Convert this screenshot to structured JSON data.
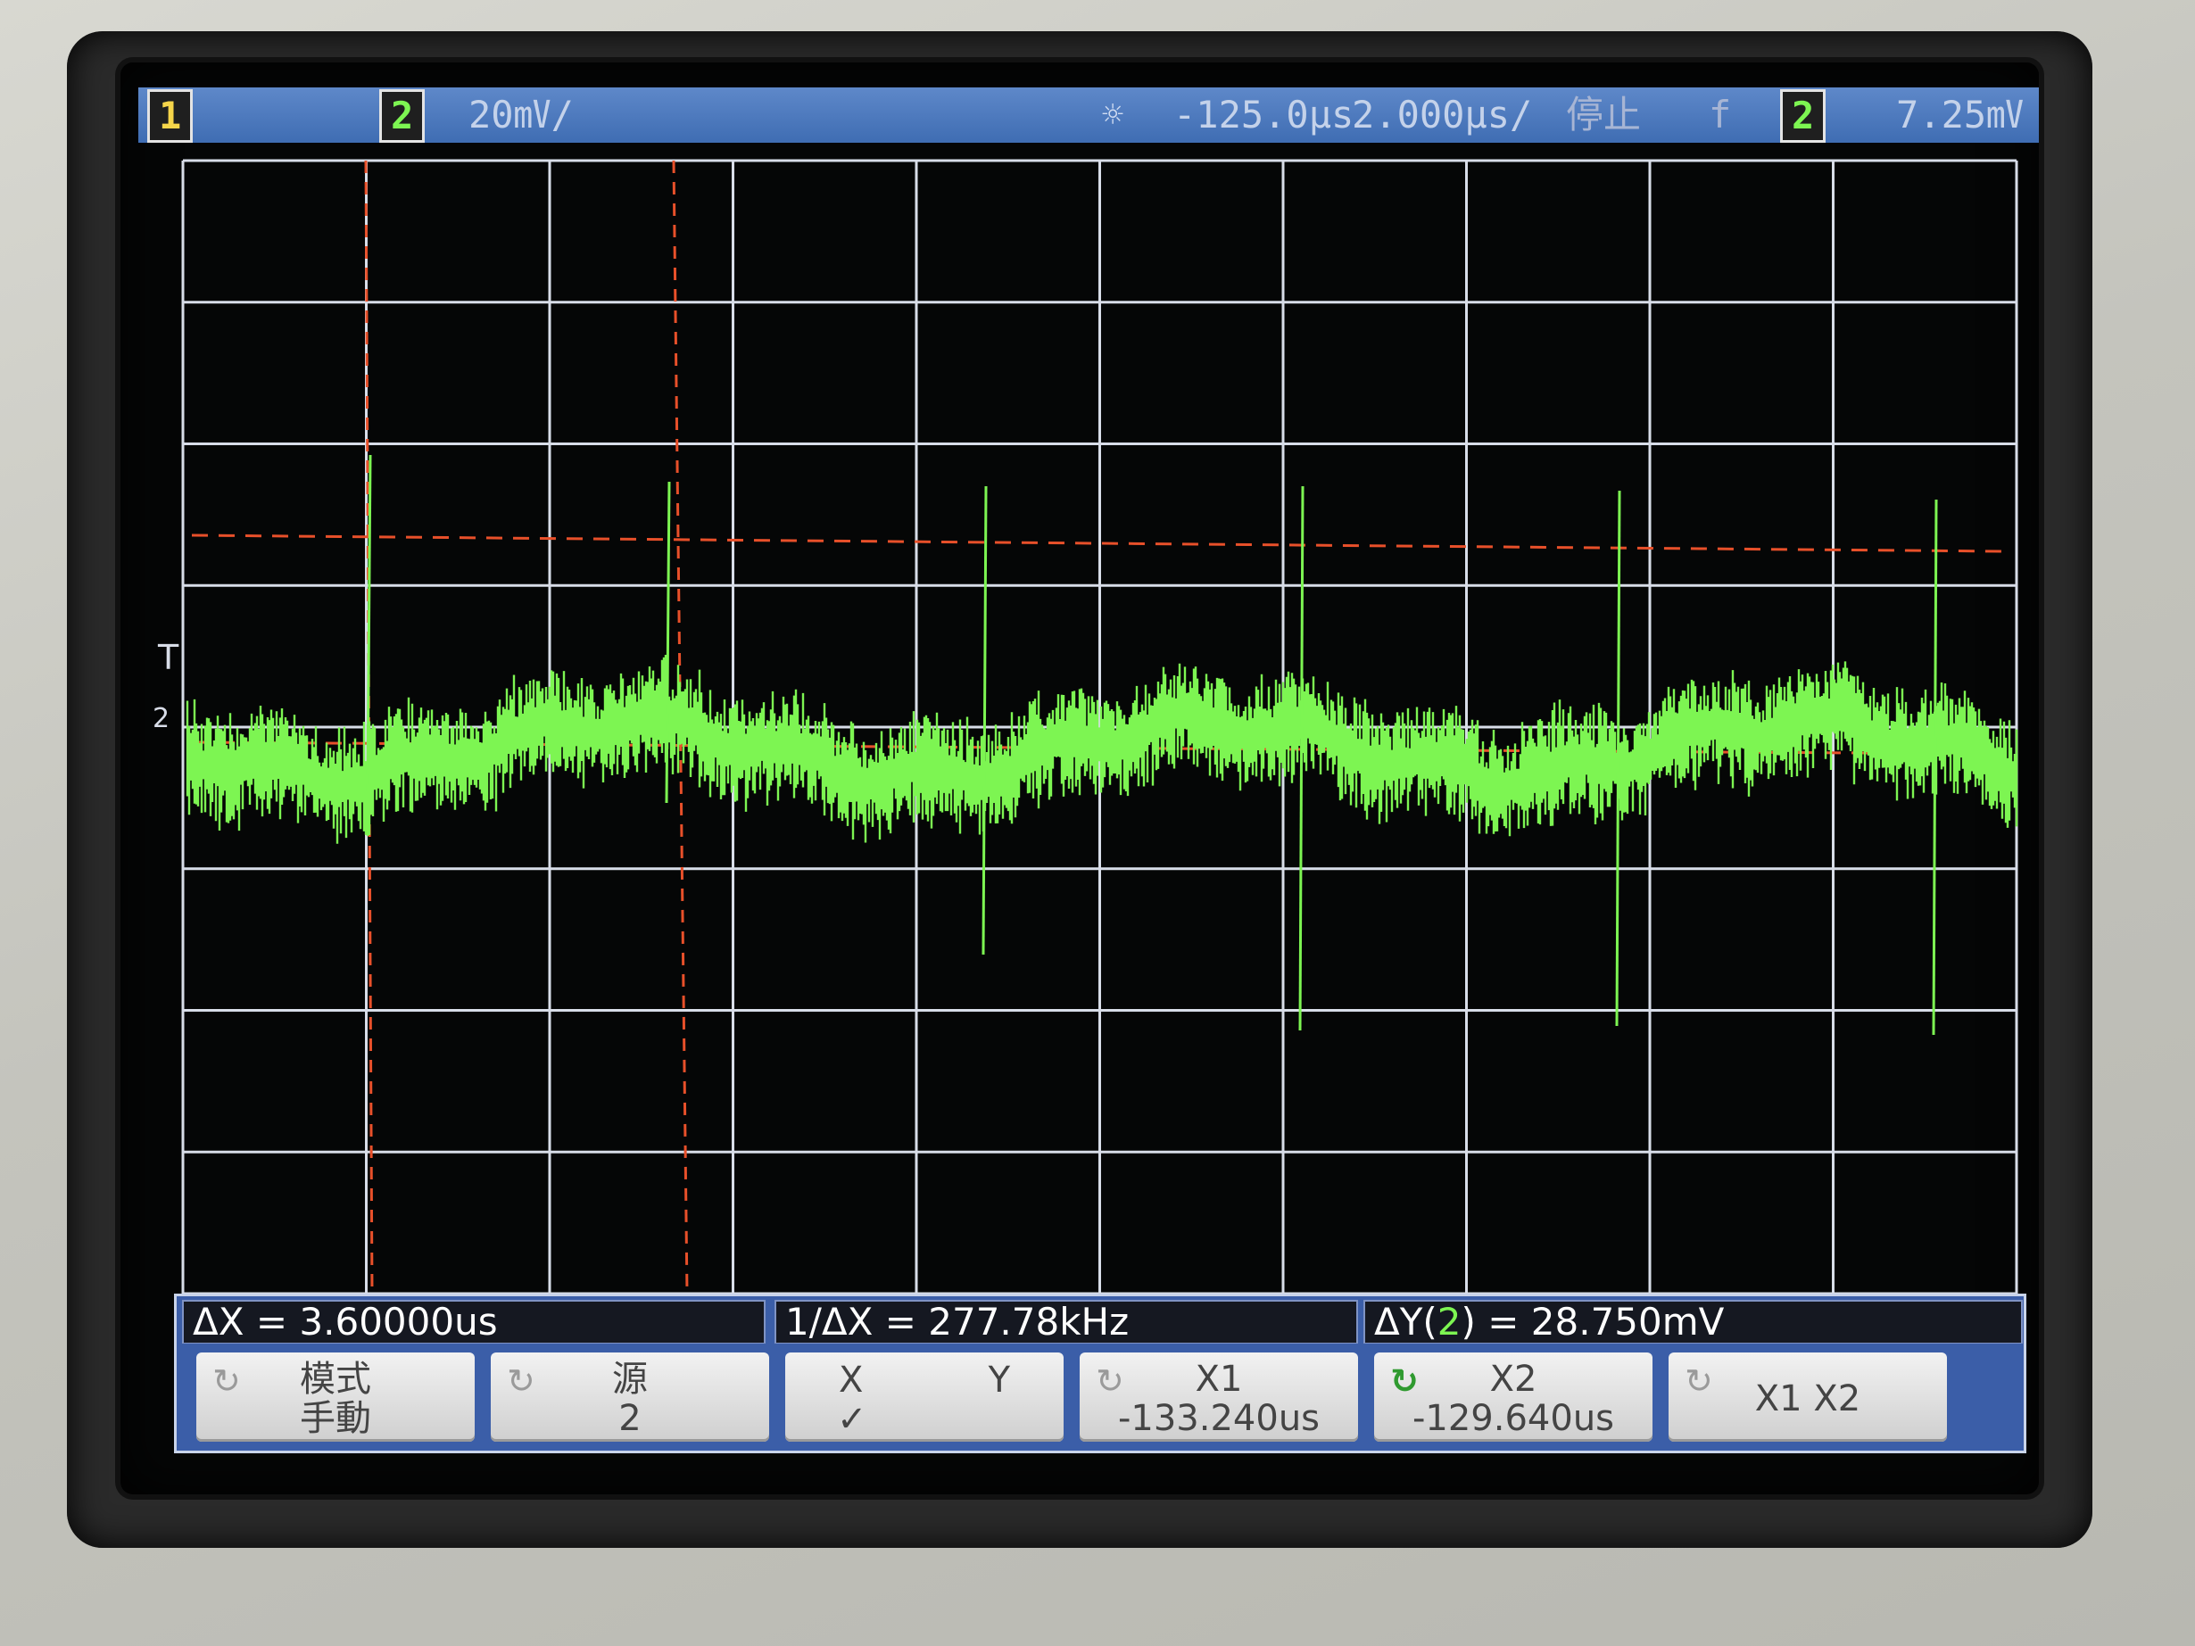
{
  "status_bar": {
    "ch1_label": "1",
    "ch2_label": "2",
    "ch2_scale": "20㎷/",
    "sun_icon": "brightness-icon",
    "time_position": "-125.0μs",
    "time_scale": "2.000μs/",
    "run_state": "停止",
    "trigger_slope_icon": "rising-edge-icon",
    "trigger_source": "2",
    "trigger_level": "7.25㎷"
  },
  "markers": {
    "trigger_marker": "T",
    "ch2_ground_marker": "2"
  },
  "readout": {
    "delta_x": "ΔX = 3.60000us",
    "inverse_delta_x": "1/ΔX = 277.78kHz",
    "delta_y_prefix": "ΔY(",
    "delta_y_channel": "2",
    "delta_y_suffix": ") = 28.750mV"
  },
  "softkeys": {
    "mode_line1": "模式",
    "mode_line2": "手動",
    "source_line1": "源",
    "source_line2": "2",
    "xy_x": "X",
    "xy_y": "Y",
    "xy_check": "✓",
    "x1_label": "X1",
    "x1_value": "-133.240us",
    "x2_label": "X2",
    "x2_value": "-129.640us",
    "x1x2_label": "X1 X2",
    "knob_icon": "↻"
  },
  "colors": {
    "trace": "#7df552",
    "cursor": "#e8502a",
    "grid": "#d8dde8",
    "status_bar": "#4a77bd"
  }
}
